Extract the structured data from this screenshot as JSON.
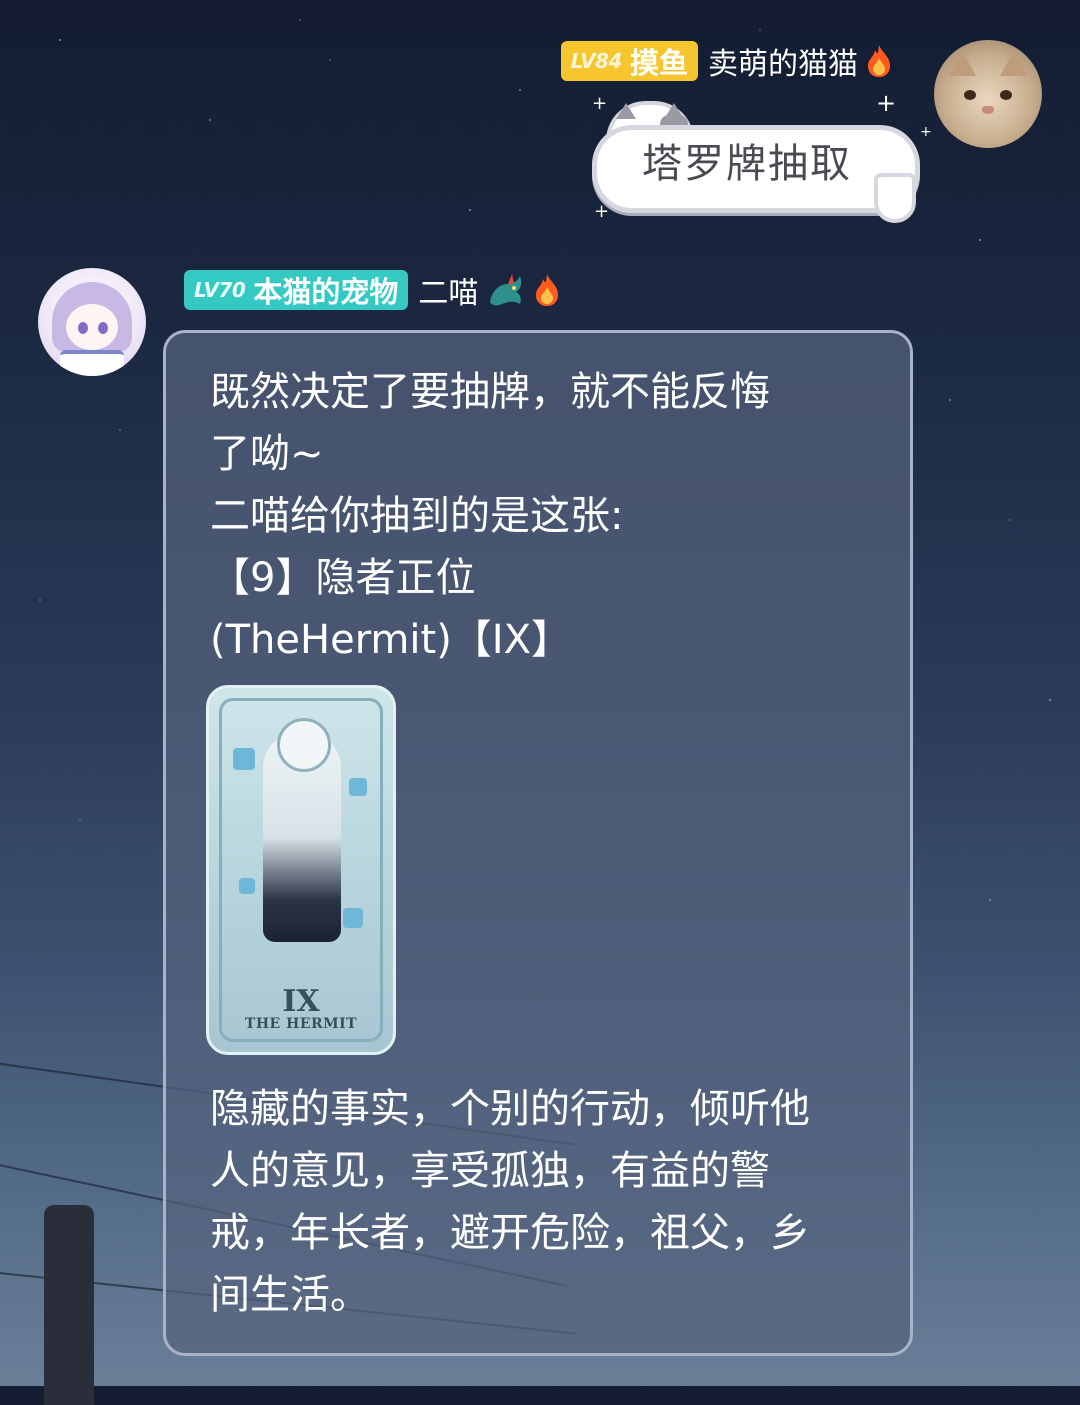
{
  "sender": {
    "level": "LV84",
    "title": "摸鱼",
    "nickname": "卖萌的猫猫",
    "badge_color": "#f7c52e",
    "avatar_icon": "cat-photo-avatar",
    "flair_icons": [
      "fire-icon"
    ]
  },
  "sticker": {
    "text": "塔罗牌抽取",
    "icon": "cat-speech-bubble-sticker"
  },
  "reply": {
    "level": "LV70",
    "title": "本猫的宠物",
    "nickname": "二喵",
    "badge_color": "#34c9c3",
    "avatar_icon": "anime-girl-avatar",
    "flair_icons": [
      "dragon-icon",
      "fire-icon"
    ],
    "message_lines": [
      "既然决定了要抽牌，就不能反悔",
      "了呦~",
      "二喵给你抽到的是这张:",
      "【9】隐者正位",
      "(TheHermit)【IX】"
    ],
    "card": {
      "numeral": "IX",
      "name": "THE HERMIT"
    },
    "meaning_lines": [
      "隐藏的事实，个别的行动，倾听他",
      "人的意见，享受孤独，有益的警",
      "戒，年长者，避开危险，祖父，乡",
      "间生活。"
    ]
  }
}
